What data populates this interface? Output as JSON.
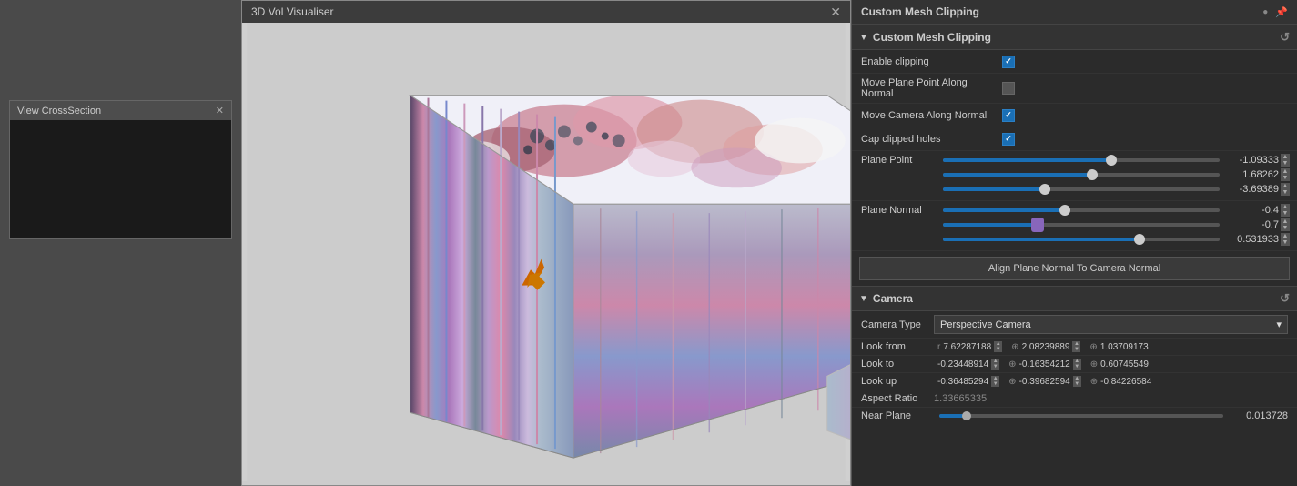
{
  "leftPanel": {
    "crossSection": {
      "title": "View CrossSection",
      "closeIcon": "✕"
    }
  },
  "visualiser": {
    "title": "3D Vol Visualiser",
    "closeIcon": "✕"
  },
  "rightPanel": {
    "title": "Custom Mesh Clipping",
    "pinIcon": "📌",
    "resetIcon": "↺",
    "section": {
      "label": "Custom Mesh Clipping",
      "resetIcon": "↺"
    },
    "properties": {
      "enableClipping": "Enable clipping",
      "movePlanePoint": "Move Plane Point Along Normal",
      "moveCameraAlong": "Move Camera Along Normal",
      "capClipped": "Cap clipped holes"
    },
    "planePoint": {
      "label": "Plane Point",
      "values": [
        "-1.09333",
        "1.68262",
        "-3.69389"
      ],
      "fills": [
        "62%",
        "55%",
        "38%"
      ],
      "thumbPositions": [
        "62%",
        "55%",
        "38%"
      ]
    },
    "planeNormal": {
      "label": "Plane Normal",
      "values": [
        "-0.4",
        "-0.7",
        "0.531933"
      ],
      "fills": [
        "45%",
        "38%",
        "72%"
      ],
      "thumbPositions": [
        "45%",
        "38%",
        "72%"
      ]
    },
    "alignButton": "Align Plane Normal To Camera Normal",
    "camera": {
      "sectionLabel": "Camera",
      "resetIcon": "↺",
      "cameraType": {
        "label": "Camera Type",
        "value": "Perspective Camera",
        "chevron": "▾"
      },
      "lookFrom": {
        "label": "Look from",
        "rLabel": "r",
        "rValue": "7.62287188",
        "xLabel": "⊕",
        "xValue": "2.08239889",
        "yLabel": "⊕",
        "yValue": "1.03709173"
      },
      "lookTo": {
        "label": "Look to",
        "v1": "-0.23448914",
        "v2": "-0.16354212",
        "v3": "0.60745549"
      },
      "lookUp": {
        "label": "Look up",
        "v1": "-0.36485294",
        "v2": "-0.39682594",
        "v3": "-0.84226584"
      },
      "aspectRatio": {
        "label": "Aspect Ratio",
        "value": "1.33665335"
      },
      "nearPlane": {
        "label": "Near Plane",
        "value": "0.013728"
      }
    }
  }
}
